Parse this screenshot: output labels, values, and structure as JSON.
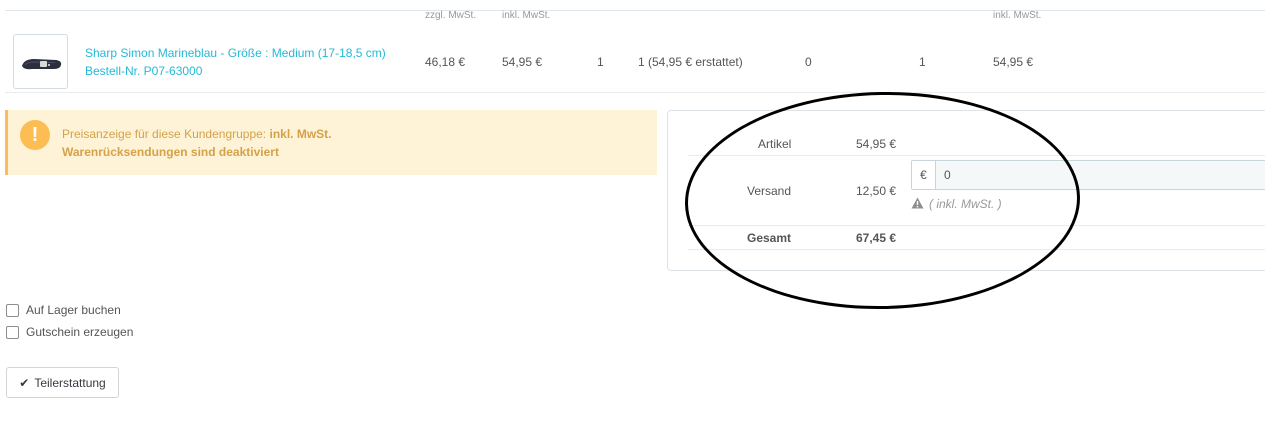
{
  "table": {
    "headers": {
      "col_zzgl": "zzgl. MwSt.",
      "col_inkl": "inkl. MwSt.",
      "col_total_inkl": "inkl. MwSt."
    },
    "row": {
      "product_name": "Sharp Simon Marineblau - Größe : Medium (17-18,5 cm)",
      "product_ref": "Bestell-Nr. P07-63000",
      "price_excl": "46,18 €",
      "price_incl": "54,95 €",
      "quantity": "1",
      "refunded": "1 (54,95 € erstattet)",
      "returned": "0",
      "qty_refund": "1",
      "total": "54,95 €"
    }
  },
  "warning": {
    "line1_prefix": "Preisanzeige für diese Kundengruppe: ",
    "line1_strong": "inkl. MwSt.",
    "line2": "Warenrücksendungen sind deaktiviert",
    "icon": "exclamation-icon",
    "color": "#fcbe54"
  },
  "summary": {
    "articles_label": "Artikel",
    "articles_value": "54,95 €",
    "shipping_label": "Versand",
    "shipping_value": "12,50 €",
    "shipping_currency": "€",
    "shipping_input_value": "0",
    "shipping_note": "( inkl. MwSt. )",
    "total_label": "Gesamt",
    "total_value": "67,45 €"
  },
  "options": {
    "restock_label": "Auf Lager buchen",
    "voucher_label": "Gutschein erzeugen"
  },
  "actions": {
    "partial_refund_label": "Teilerstattung"
  },
  "colors": {
    "link": "#25b9d7",
    "warning_bg": "#fff3d7",
    "warning_text": "#d3a249"
  }
}
